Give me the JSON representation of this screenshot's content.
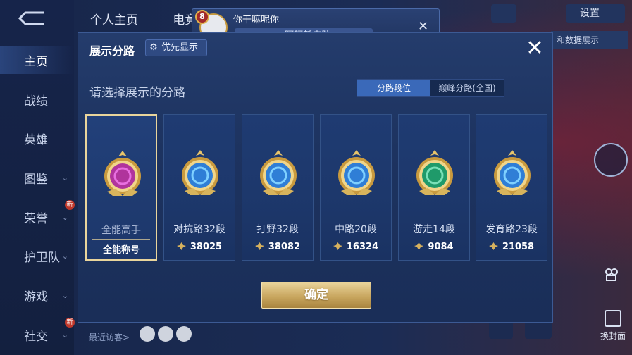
{
  "background": {
    "top_tabs": [
      "个人主页",
      "电竞"
    ],
    "settings_label": "设置",
    "data_display_label": "和数据展示",
    "nav_items": [
      {
        "label": "主页",
        "active": true,
        "chevron": false,
        "dot": false
      },
      {
        "label": "战绩",
        "active": false,
        "chevron": false,
        "dot": false
      },
      {
        "label": "英雄",
        "active": false,
        "chevron": false,
        "dot": false
      },
      {
        "label": "图鉴",
        "active": false,
        "chevron": true,
        "dot": false
      },
      {
        "label": "荣誉",
        "active": false,
        "chevron": true,
        "dot": true
      },
      {
        "label": "护卫队",
        "active": false,
        "chevron": true,
        "dot": false
      },
      {
        "label": "游戏",
        "active": false,
        "chevron": true,
        "dot": false
      },
      {
        "label": "社交",
        "active": false,
        "chevron": true,
        "dot": true
      }
    ],
    "new_dot_label": "新",
    "recent_visitors_label": "最近访客>",
    "change_cover_label": "换封面"
  },
  "notification": {
    "level": "8",
    "message": "你干嘛呢你",
    "skin_button_label": "◕阿轲新皮肤",
    "close_label": "✕"
  },
  "modal": {
    "title": "展示分路",
    "priority_label": "优先显示",
    "close_label": "✕",
    "prompt": "请选择展示的分路",
    "tabs": [
      {
        "label": "分路段位",
        "active": true
      },
      {
        "label": "巅峰分路(全国)",
        "active": false
      }
    ],
    "cards": [
      {
        "name": "全能高手",
        "value": "全能称号",
        "selected": true,
        "badge_color": "#b0349c",
        "badge_inner": "#e86fe0",
        "icon": "all-round-icon"
      },
      {
        "name": "对抗路32段",
        "value": "38025",
        "selected": false,
        "badge_color": "#2f7ed6",
        "badge_inner": "#7fd0ff",
        "icon": "clash-lane-icon"
      },
      {
        "name": "打野32段",
        "value": "38082",
        "selected": false,
        "badge_color": "#2f7ed6",
        "badge_inner": "#7fd0ff",
        "icon": "jungle-icon"
      },
      {
        "name": "中路20段",
        "value": "16324",
        "selected": false,
        "badge_color": "#2f7ed6",
        "badge_inner": "#7fd0ff",
        "icon": "mid-lane-icon"
      },
      {
        "name": "游走14段",
        "value": "9084",
        "selected": false,
        "badge_color": "#1f9a6a",
        "badge_inner": "#78e0b8",
        "icon": "roam-icon"
      },
      {
        "name": "发育路23段",
        "value": "21058",
        "selected": false,
        "badge_color": "#2f7ed6",
        "badge_inner": "#7fd0ff",
        "icon": "farm-lane-icon"
      }
    ],
    "confirm_label": "确定"
  }
}
